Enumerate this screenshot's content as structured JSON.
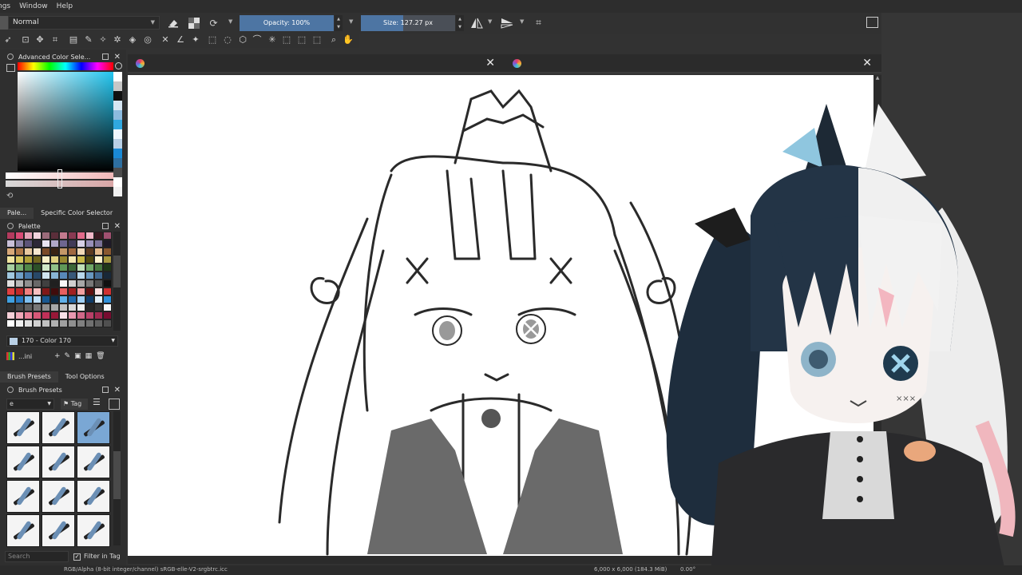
{
  "menubar": {
    "items": [
      "ngs",
      "Window",
      "Help"
    ]
  },
  "toolbar": {
    "blend_mode": "Normal",
    "opacity_label": "Opacity: 100%",
    "opacity_fraction": 1.0,
    "size_label": "Size: 127.27 px",
    "size_fraction": 0.45
  },
  "color_selector": {
    "title": "Advanced Color Sele...",
    "hue_colors": [
      "#ff0000",
      "#ffff00",
      "#00ff00",
      "#00ffff",
      "#0000ff",
      "#ff00ff"
    ],
    "selected_color": "#22c6f0",
    "history_swatches": [
      "#ffffff",
      "#c7c7c7",
      "#101010",
      "#d6e6f3",
      "#8cbbdf",
      "#30a8e0",
      "#eef7ff",
      "#b9d0e6",
      "#1a8ad6",
      "#2e6fa0",
      "#4d4d4d",
      "#ffffff",
      "#f1f1f1"
    ]
  },
  "palette_tabs": {
    "tab1": "Pale...",
    "tab2": "Specific Color Selector"
  },
  "palette": {
    "title": "Palette",
    "selected_color_name": "170 - Color 170",
    "palette_name": "...ini",
    "colors": [
      "#b33b5e",
      "#d94b75",
      "#e5a3b7",
      "#f2d4dd",
      "#9b6b7a",
      "#5a2e3a",
      "#c47a8e",
      "#8a3a52",
      "#e26a8a",
      "#f0b8c8",
      "#3a1a22",
      "#a05070",
      "#c9c0d8",
      "#8e86a8",
      "#5c5478",
      "#2d2838",
      "#e8e4f2",
      "#b0a8c8",
      "#6e6690",
      "#403a58",
      "#d6d0e6",
      "#9890b8",
      "#7a7298",
      "#1e1a28",
      "#d8a878",
      "#b07848",
      "#e8c8a0",
      "#f6e6d0",
      "#7a4a28",
      "#3a2414",
      "#c49868",
      "#a06840",
      "#f0d8b8",
      "#5c3a20",
      "#e2b88a",
      "#8a5830",
      "#f2e6a0",
      "#d8c860",
      "#b0a038",
      "#706620",
      "#f8f0c8",
      "#e0d080",
      "#988830",
      "#f4e8b0",
      "#c8b848",
      "#504810",
      "#fff4d0",
      "#a89840",
      "#a8d0a0",
      "#78b070",
      "#508848",
      "#2c5028",
      "#d0e8c8",
      "#90c088",
      "#609858",
      "#3c6838",
      "#c0e0b8",
      "#70a868",
      "#487840",
      "#203818",
      "#a0c8e0",
      "#70a0c8",
      "#4878a8",
      "#284868",
      "#d0e4f0",
      "#88b4d4",
      "#5888b8",
      "#385878",
      "#b8d8ec",
      "#6898c0",
      "#406890",
      "#182838",
      "#e0e0e0",
      "#b8b8b8",
      "#909090",
      "#686868",
      "#404040",
      "#202020",
      "#f8f8f8",
      "#d0d0d0",
      "#a8a8a8",
      "#787878",
      "#505050",
      "#101010",
      "#e04040",
      "#c02828",
      "#f08080",
      "#f8c0c0",
      "#801818",
      "#400c0c",
      "#e86060",
      "#a02020",
      "#f4a0a0",
      "#601010",
      "#ffe0e0",
      "#d03030",
      "#40a0e0",
      "#2878c0",
      "#80c0f0",
      "#c0e0f8",
      "#185890",
      "#0c2c48",
      "#60b0e8",
      "#2068a8",
      "#a0d0f4",
      "#103c68",
      "#e0f0fc",
      "#3090d8",
      "#303030",
      "#484848",
      "#606060",
      "#787878",
      "#909090",
      "#a8a8a8",
      "#c0c0c0",
      "#d8d8d8",
      "#f0f0f0",
      "#282828",
      "#383838",
      "#f8f8f8",
      "#f6d0d8",
      "#f0a8b8",
      "#e88098",
      "#d85878",
      "#c03058",
      "#981838",
      "#f8e0e8",
      "#e898b0",
      "#d06888",
      "#b84068",
      "#a02850",
      "#780c30",
      "#ffffff",
      "#f0f0f0",
      "#e0e0e0",
      "#d0d0d0",
      "#c0c0c0",
      "#b0b0b0",
      "#a0a0a0",
      "#909090",
      "#808080",
      "#707070",
      "#606060",
      "#505050"
    ]
  },
  "brush_tabs": {
    "tab1": "Brush Presets",
    "tab2": "Tool Options"
  },
  "brush_presets": {
    "title": "Brush Presets",
    "filter_value": "e",
    "tag_label": "Tag",
    "count": 12,
    "selected_index": 2
  },
  "search": {
    "placeholder": "Search",
    "filter_in_tag": "Filter in Tag"
  },
  "status": {
    "left": "RGB/Alpha (8-bit integer/channel)  sRGB-elle-V2-srgbtrc.icc",
    "right": "6,000 x 6,000 (184.3 MiB)",
    "zoom": "0.00°"
  },
  "colors": {
    "accent": "#4d75a3",
    "bg": "#323232",
    "panel": "#2f2f2f"
  }
}
